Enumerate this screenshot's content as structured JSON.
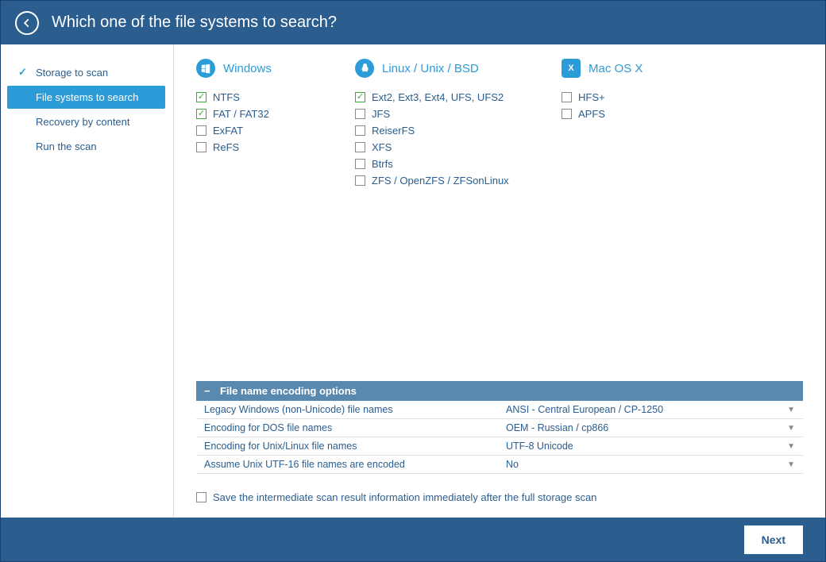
{
  "header": {
    "title": "Which one of the file systems to search?"
  },
  "sidebar": {
    "items": [
      {
        "label": "Storage to scan",
        "state": "done"
      },
      {
        "label": "File systems to search",
        "state": "active"
      },
      {
        "label": "Recovery by content",
        "state": ""
      },
      {
        "label": "Run the scan",
        "state": ""
      }
    ]
  },
  "fs_groups": [
    {
      "name": "windows",
      "title": "Windows",
      "items": [
        {
          "label": "NTFS",
          "checked": true
        },
        {
          "label": "FAT / FAT32",
          "checked": true
        },
        {
          "label": "ExFAT",
          "checked": false
        },
        {
          "label": "ReFS",
          "checked": false
        }
      ]
    },
    {
      "name": "linux",
      "title": "Linux / Unix / BSD",
      "items": [
        {
          "label": "Ext2, Ext3, Ext4, UFS, UFS2",
          "checked": true
        },
        {
          "label": "JFS",
          "checked": false
        },
        {
          "label": "ReiserFS",
          "checked": false
        },
        {
          "label": "XFS",
          "checked": false
        },
        {
          "label": "Btrfs",
          "checked": false
        },
        {
          "label": "ZFS / OpenZFS / ZFSonLinux",
          "checked": false
        }
      ]
    },
    {
      "name": "mac",
      "title": "Mac OS X",
      "items": [
        {
          "label": "HFS+",
          "checked": false
        },
        {
          "label": "APFS",
          "checked": false
        }
      ]
    }
  ],
  "encoding": {
    "title": "File name encoding options",
    "rows": [
      {
        "label": "Legacy Windows (non-Unicode) file names",
        "value": "ANSI - Central European / CP-1250"
      },
      {
        "label": "Encoding for DOS file names",
        "value": "OEM - Russian / cp866"
      },
      {
        "label": "Encoding for Unix/Linux file names",
        "value": "UTF-8 Unicode"
      },
      {
        "label": "Assume Unix UTF-16 file names are encoded",
        "value": "No"
      }
    ]
  },
  "save_option": {
    "label": "Save the intermediate scan result information immediately after the full storage scan",
    "checked": false
  },
  "footer": {
    "next": "Next"
  }
}
